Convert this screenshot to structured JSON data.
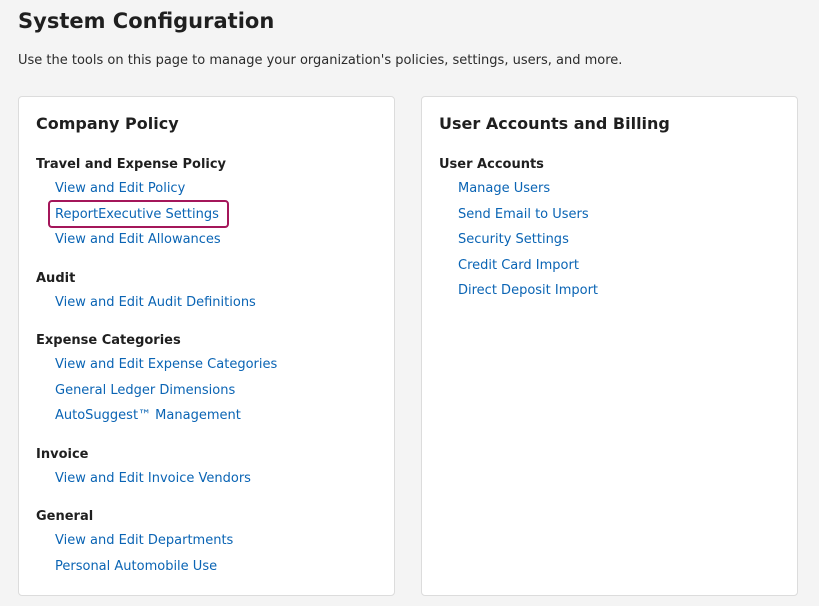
{
  "page": {
    "title": "System Configuration",
    "description": "Use the tools on this page to manage your organization's policies, settings, users, and more."
  },
  "highlight_color": "#a4165a",
  "link_color": "#0a64b4",
  "cards": [
    {
      "title": "Company Policy",
      "sections": [
        {
          "title": "Travel and Expense Policy",
          "links": [
            "View and Edit Policy",
            "ReportExecutive Settings",
            "View and Edit Allowances"
          ]
        },
        {
          "title": "Audit",
          "links": [
            "View and Edit Audit Definitions"
          ]
        },
        {
          "title": "Expense Categories",
          "links": [
            "View and Edit Expense Categories",
            "General Ledger Dimensions",
            "AutoSuggest™ Management"
          ]
        },
        {
          "title": "Invoice",
          "links": [
            "View and Edit Invoice Vendors"
          ]
        },
        {
          "title": "General",
          "links": [
            "View and Edit Departments",
            "Personal Automobile Use"
          ]
        }
      ]
    },
    {
      "title": "User Accounts and Billing",
      "sections": [
        {
          "title": "User Accounts",
          "links": [
            "Manage Users",
            "Send Email to Users",
            "Security Settings",
            "Credit Card Import",
            "Direct Deposit Import"
          ]
        }
      ]
    }
  ]
}
